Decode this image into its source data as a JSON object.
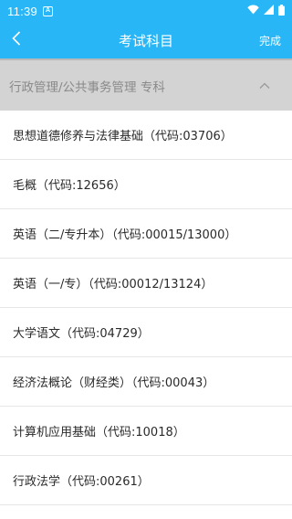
{
  "status_bar": {
    "time": "11:39",
    "notification_badge": "A",
    "icons": [
      "wifi-icon",
      "signal-icon",
      "battery-icon"
    ]
  },
  "nav": {
    "title": "考试科目",
    "done_label": "完成",
    "back_icon": "chevron-left-icon"
  },
  "category": {
    "label": "行政管理/公共事务管理 专科",
    "toggle_icon": "chevron-up-icon"
  },
  "subjects": [
    "思想道德修养与法律基础（代码:03706）",
    "毛概（代码:12656）",
    "英语（二/专升本）（代码:00015/13000）",
    "英语（一/专）（代码:00012/13124）",
    "大学语文（代码:04729）",
    "经济法概论（财经类）（代码:00043）",
    "计算机应用基础（代码:10018）",
    "行政法学（代码:00261）"
  ],
  "colors": {
    "primary": "#29b6f6",
    "category_bg": "#d3d3d3",
    "category_text": "#8a8a8a"
  }
}
